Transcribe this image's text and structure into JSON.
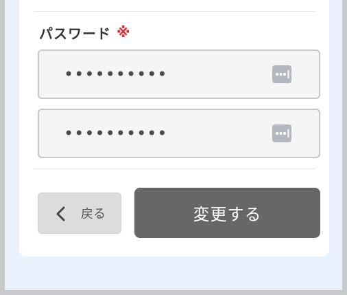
{
  "form": {
    "password_label": "パスワード",
    "required_mark": "※",
    "password_value": "••••••••••",
    "password_confirm_value": "••••••••••"
  },
  "actions": {
    "back_label": "戻る",
    "submit_label": "変更する"
  },
  "icons": {
    "reveal": "password-reveal-icon",
    "back": "chevron-left-icon"
  },
  "colors": {
    "required": "#e2262c",
    "submit_bg": "#676767",
    "back_bg": "#dcdcdd",
    "background": "#e9f2fc"
  }
}
